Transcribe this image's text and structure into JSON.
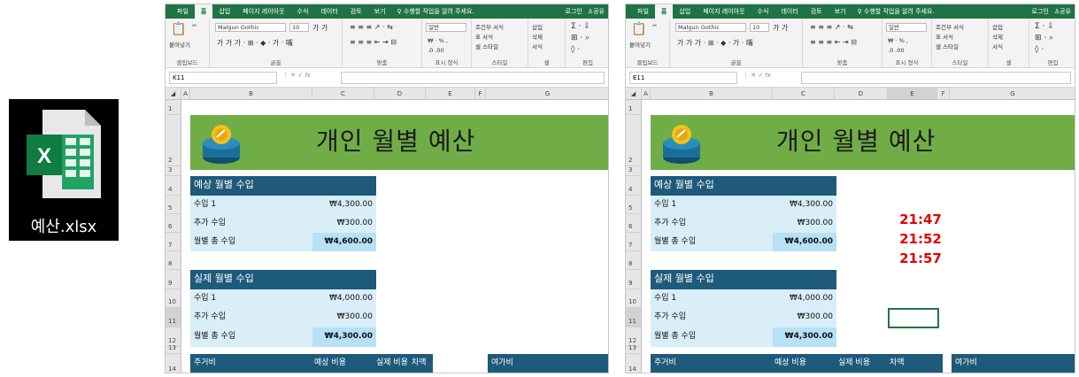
{
  "file": {
    "name": "예산.xlsx"
  },
  "ribbon": {
    "tabs": [
      "파일",
      "홈",
      "삽입",
      "페이지 레이아웃",
      "수식",
      "데이터",
      "검토",
      "보기"
    ],
    "tell_me": "수행할 작업을 알려 주세요.",
    "login": "로그인",
    "share": "공유",
    "paste": "붙여넣기",
    "font_name": "Malgun Gothic",
    "font_size": "10",
    "number_format": "일반",
    "conditional": "조건부 서식",
    "table_format": "표 서식",
    "cell_style": "셀 스타일",
    "insert": "삽입",
    "delete": "삭제",
    "format": "서식",
    "groups": [
      "클립보드",
      "글꼴",
      "맞춤",
      "표시 형식",
      "스타일",
      "셀",
      "편집"
    ]
  },
  "left": {
    "namebox": "K11"
  },
  "right": {
    "namebox": "E11"
  },
  "columns": [
    "A",
    "B",
    "C",
    "D",
    "E",
    "F",
    "G"
  ],
  "sheet": {
    "title": "개인 월별 예산",
    "expected": {
      "header": "예상 월별 수입",
      "rows": [
        {
          "label": "수입 1",
          "value": "₩4,300.00"
        },
        {
          "label": "추가 수입",
          "value": "₩300.00"
        },
        {
          "label": "월별 총 수입",
          "value": "₩4,600.00"
        }
      ]
    },
    "actual": {
      "header": "실제 월별 수입",
      "rows": [
        {
          "label": "수입 1",
          "value": "₩4,000.00"
        },
        {
          "label": "추가 수입",
          "value": "₩300.00"
        },
        {
          "label": "월별 총 수입",
          "value": "₩4,300.00"
        }
      ]
    },
    "footer": {
      "housing": "주거비",
      "expected_cost": "예상 비용",
      "actual_cost": "실제 비용",
      "diff": "차액",
      "leisure": "여가비"
    }
  },
  "times": [
    "21:47",
    "21:52",
    "21:57"
  ]
}
